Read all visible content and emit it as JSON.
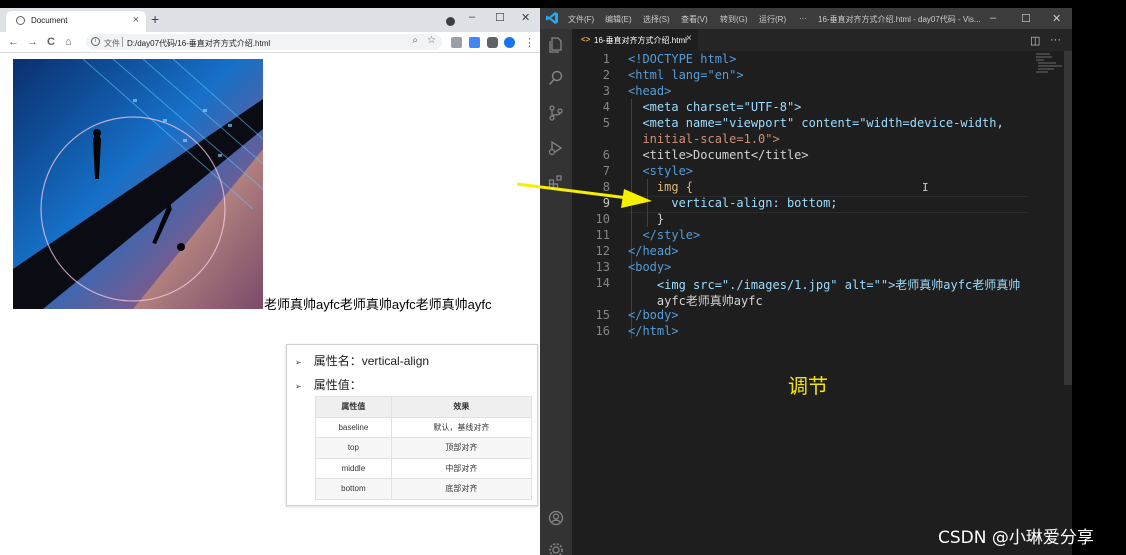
{
  "browser": {
    "tab_title": "Document",
    "tab_close": "×",
    "new_tab": "+",
    "window_controls": [
      "–",
      "☐",
      "✕"
    ],
    "nav": [
      "←",
      "→",
      "C",
      "⌂"
    ],
    "url_label": "文件",
    "url": "D:/day07代码/16-垂直对齐方式介绍.html",
    "toolbar_menu": "⋮",
    "icons": [
      "info-icon",
      "zoom-icon",
      "star-icon",
      "extension-icons",
      "profile-icon"
    ]
  },
  "page": {
    "demo_text": "老师真帅ayfc老师真帅ayfc老师真帅ayfc",
    "slide": {
      "bullets": [
        {
          "marker": "➢",
          "text": "属性名：vertical-align"
        },
        {
          "marker": "➢",
          "text": "属性值："
        }
      ],
      "table": {
        "headers": [
          "属性值",
          "效果"
        ],
        "rows": [
          [
            "baseline",
            "默认，基线对齐"
          ],
          [
            "top",
            "顶部对齐"
          ],
          [
            "middle",
            "中部对齐"
          ],
          [
            "bottom",
            "底部对齐"
          ]
        ]
      }
    }
  },
  "vscode": {
    "menu": [
      "文件(F)",
      "编辑(E)",
      "选择(S)",
      "查看(V)",
      "转到(G)",
      "运行(R)",
      "···"
    ],
    "title": "16-垂直对齐方式介绍.html - day07代码 - Vis...",
    "window_controls": [
      "–",
      "☐",
      "✕"
    ],
    "tab": {
      "name": "16-垂直对齐方式介绍.html",
      "close": "×"
    },
    "tab_actions": [
      "▯▯",
      "···"
    ],
    "line_numbers": [
      "1",
      "2",
      "3",
      "4",
      "5",
      "",
      "6",
      "7",
      "8",
      "9",
      "10",
      "11",
      "12",
      "13",
      "14",
      "",
      "15",
      "16"
    ],
    "code_lines": [
      "<!DOCTYPE html>",
      "<html lang=\"en\">",
      "<head>",
      "  <meta charset=\"UTF-8\">",
      "  <meta name=\"viewport\" content=\"width=device-width,",
      "  initial-scale=1.0\">",
      "  <title>Document</title>",
      "  <style>",
      "    img {",
      "      vertical-align: bottom;",
      "    }",
      "  </style>",
      "</head>",
      "<body>",
      "    <img src=\"./images/1.jpg\" alt=\"\">老师真帅ayfc老师真帅",
      "    ayfc老师真帅ayfc",
      "</body>",
      "</html>"
    ],
    "annotation": "调节"
  },
  "watermark": "CSDN @小琳爱分享",
  "colors": {
    "vscode_bg": "#1e1e1e",
    "keyword_blue": "#569cd6",
    "attr_lightblue": "#9cdcfe",
    "string_orange": "#ce9178",
    "annotation_yellow": "#f5e500"
  }
}
